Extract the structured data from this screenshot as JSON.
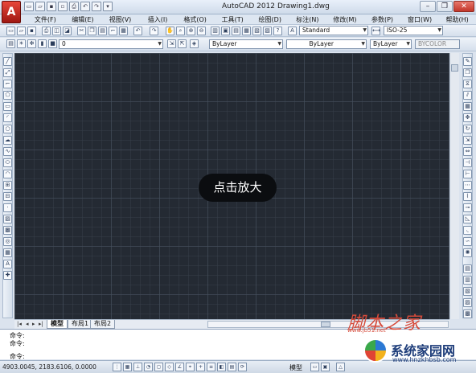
{
  "window": {
    "app_title": "AutoCAD 2012",
    "doc_title": "Drawing1.dwg",
    "logo_letter": "A",
    "min_label": "–",
    "restore_label": "❐",
    "close_label": "✕"
  },
  "menu": [
    "文件(F)",
    "编辑(E)",
    "视图(V)",
    "插入(I)",
    "格式(O)",
    "工具(T)",
    "绘图(D)",
    "标注(N)",
    "修改(M)",
    "参数(P)",
    "窗口(W)",
    "帮助(H)"
  ],
  "toolbar1": {
    "text_style": "Standard",
    "dim_style": "ISO-25"
  },
  "toolbar2": {
    "layer_value": "0",
    "color_value": "ByLayer",
    "linetype_value": "ByLayer",
    "lineweight_value": "ByLayer",
    "plotstyle_value": "BYCOLOR"
  },
  "overlay": {
    "zoom_label": "点击放大"
  },
  "tabs": {
    "model": "模型",
    "layout1": "布局1",
    "layout2": "布局2"
  },
  "command": {
    "history1": "命令:",
    "history2": "命令:",
    "prompt": "命令:"
  },
  "status": {
    "coords": "4903.0045, 2183.6106, 0.0000",
    "model_label": "模型"
  },
  "watermark": {
    "top_text": "脚本之家",
    "top_url": "www.jb51.net",
    "brand": "系统家园网",
    "brand_url": "www.hnzkhbsb.com"
  },
  "colors": {
    "canvas_bg": "#242a33",
    "badge_bg": "#0b0d10",
    "logo_red": "#c8281e"
  }
}
